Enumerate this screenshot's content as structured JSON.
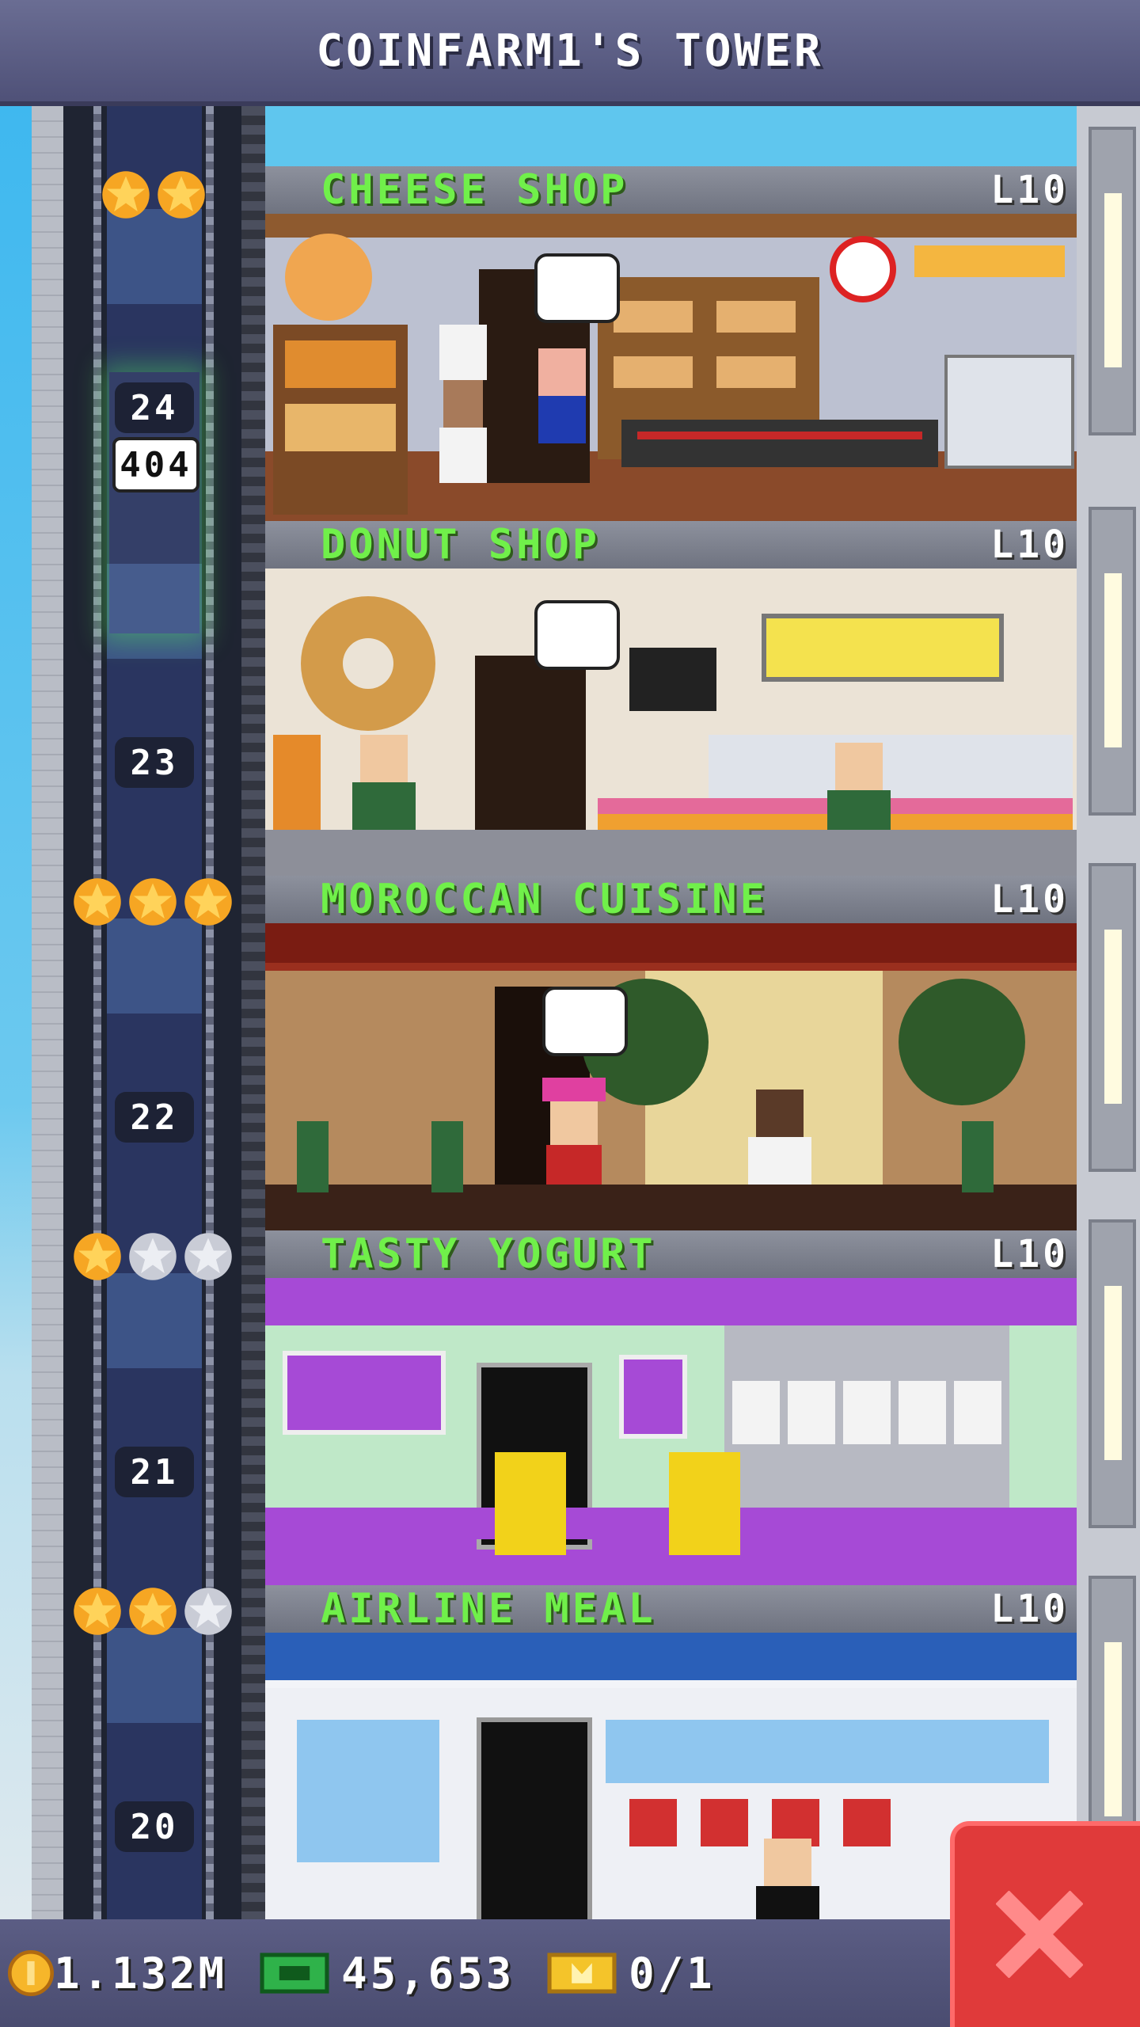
{
  "header": {
    "title": "COINFARM1'S TOWER"
  },
  "elevator": {
    "display_text": "404"
  },
  "floors": [
    {
      "number": "24",
      "name": "CHEESE SHOP",
      "level": "L10",
      "stars_gold": 2,
      "stars_total": 2
    },
    {
      "number": "23",
      "name": "DONUT SHOP",
      "level": "L10",
      "stars_gold": 0,
      "stars_total": 0
    },
    {
      "number": "22",
      "name": "MOROCCAN CUISINE",
      "level": "L10",
      "stars_gold": 3,
      "stars_total": 3
    },
    {
      "number": "21",
      "name": "TASTY YOGURT",
      "level": "L10",
      "stars_gold": 1,
      "stars_total": 3
    },
    {
      "number": "20",
      "name": "AIRLINE MEAL",
      "level": "L10",
      "stars_gold": 2,
      "stars_total": 3
    }
  ],
  "status": {
    "coins": "1.132M",
    "bux": "45,653",
    "tickets": "0/1"
  },
  "colors": {
    "title_bar": "#5b5d84",
    "floor_name": "#70f04a",
    "close_button": "#e03a3a",
    "gold_star": "#f6a623",
    "silver_star": "#c9ccd6"
  },
  "icons": {
    "coin": "coin-icon",
    "bux": "bux-icon",
    "ticket": "ticket-icon",
    "close": "close-icon",
    "star": "star-icon"
  }
}
